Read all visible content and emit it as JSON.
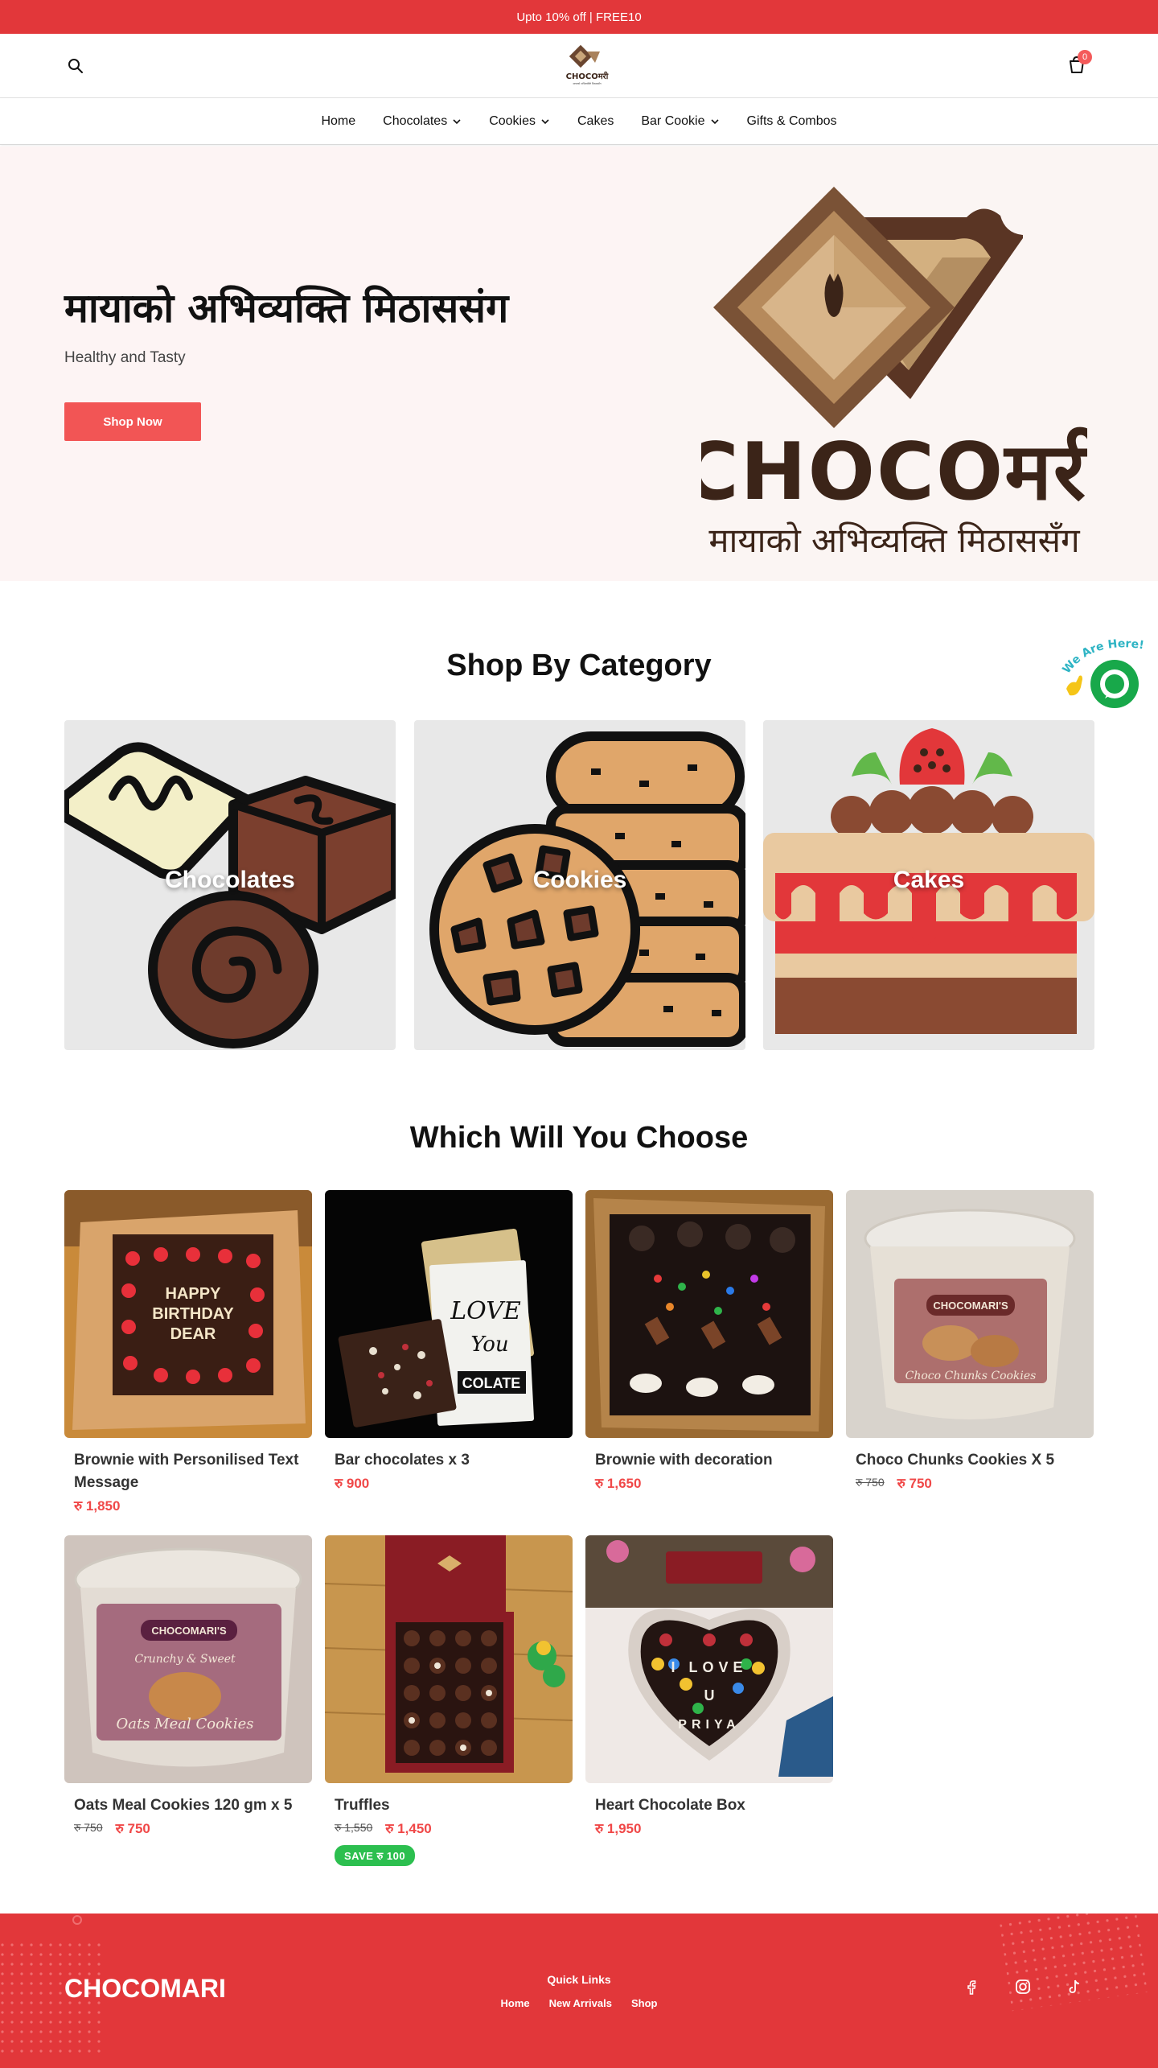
{
  "announcement": "Upto 10% off | FREE10",
  "header": {
    "logo_text": "CHOCOमरी",
    "cart_count": "0"
  },
  "nav": {
    "items": [
      {
        "label": "Home",
        "has_dropdown": false
      },
      {
        "label": "Chocolates",
        "has_dropdown": true
      },
      {
        "label": "Cookies",
        "has_dropdown": true
      },
      {
        "label": "Cakes",
        "has_dropdown": false
      },
      {
        "label": "Bar Cookie",
        "has_dropdown": true
      },
      {
        "label": "Gifts & Combos",
        "has_dropdown": false
      }
    ]
  },
  "hero": {
    "title": "मायाको अभिव्यक्ति मिठाससंग",
    "subtitle": "Healthy and Tasty",
    "cta": "Shop Now",
    "logo_word": "CHOCOमरी",
    "logo_tagline": "मायाको अभिव्यक्ति मिठाससँग"
  },
  "categories": {
    "title": "Shop By Category",
    "items": [
      {
        "label": "Chocolates"
      },
      {
        "label": "Cookies"
      },
      {
        "label": "Cakes"
      }
    ]
  },
  "chat": {
    "label": "We Are Here!"
  },
  "products": {
    "title": "Which Will You Choose",
    "items": [
      {
        "name": "Brownie with Personilised Text Message",
        "price": "रु 1,850",
        "old_price": "",
        "image_text": "HAPPY BIRTHDAY DEAR"
      },
      {
        "name": "Bar chocolates x 3",
        "price": "रु 900",
        "old_price": "",
        "image_text": "LOVE You COLATE"
      },
      {
        "name": "Brownie with decoration",
        "price": "रु 1,650",
        "old_price": "",
        "image_text": ""
      },
      {
        "name": "Choco Chunks Cookies X 5",
        "price": "रु 750",
        "old_price": "रु 750",
        "image_text": "CHOCOMARI'S"
      },
      {
        "name": "Oats Meal Cookies 120 gm x 5",
        "price": "रु 750",
        "old_price": "रु 750",
        "image_text": "CHOCOMARI'S"
      },
      {
        "name": "Truffles",
        "price": "रु 1,450",
        "old_price": "रु 1,550",
        "save": "SAVE रु 100",
        "image_text": ""
      },
      {
        "name": "Heart Chocolate Box",
        "price": "रु 1,950",
        "old_price": "",
        "image_text": "I LOVE U PRIYA"
      }
    ]
  },
  "footer": {
    "brand": "CHOCOMARI",
    "quick_links_title": "Quick Links",
    "links": [
      "Home",
      "New Arrivals",
      "Shop"
    ],
    "social": [
      "facebook-icon",
      "instagram-icon",
      "tiktok-icon"
    ]
  },
  "colors": {
    "accent": "#e2373a",
    "button": "#f25555",
    "price": "#f04848",
    "save": "#2cbf4f",
    "chocolate": "#4a2a1f"
  }
}
